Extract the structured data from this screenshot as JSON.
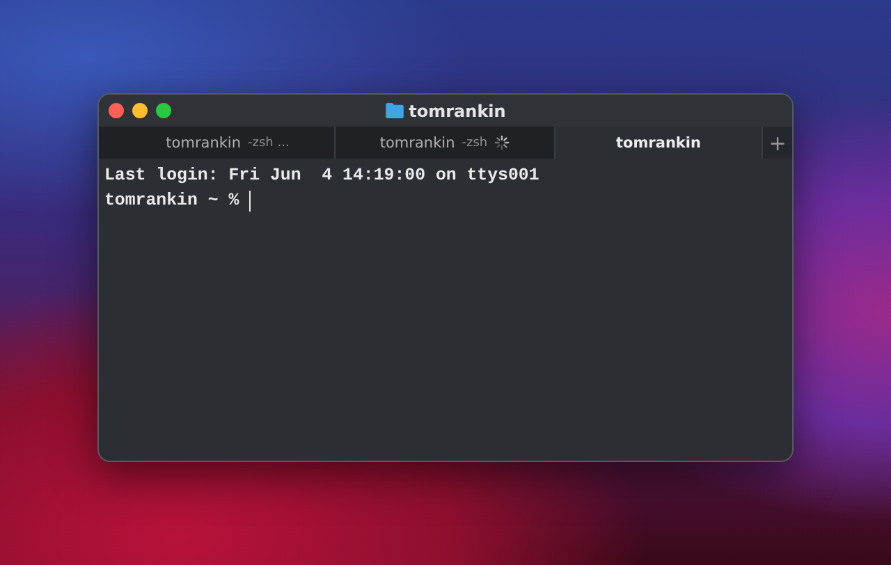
{
  "window": {
    "title": "tomrankin"
  },
  "tabs": [
    {
      "title": "tomrankin",
      "subtitle": "-zsh ...",
      "selected": false,
      "busy": false
    },
    {
      "title": "tomrankin",
      "subtitle": "-zsh",
      "selected": false,
      "busy": true
    },
    {
      "title": "tomrankin",
      "selected": true,
      "busy": false
    }
  ],
  "new_tab": "+",
  "terminal": {
    "lines": [
      "Last login: Fri Jun  4 14:19:00 on ttys001"
    ],
    "prompt": "tomrankin ~ %"
  }
}
